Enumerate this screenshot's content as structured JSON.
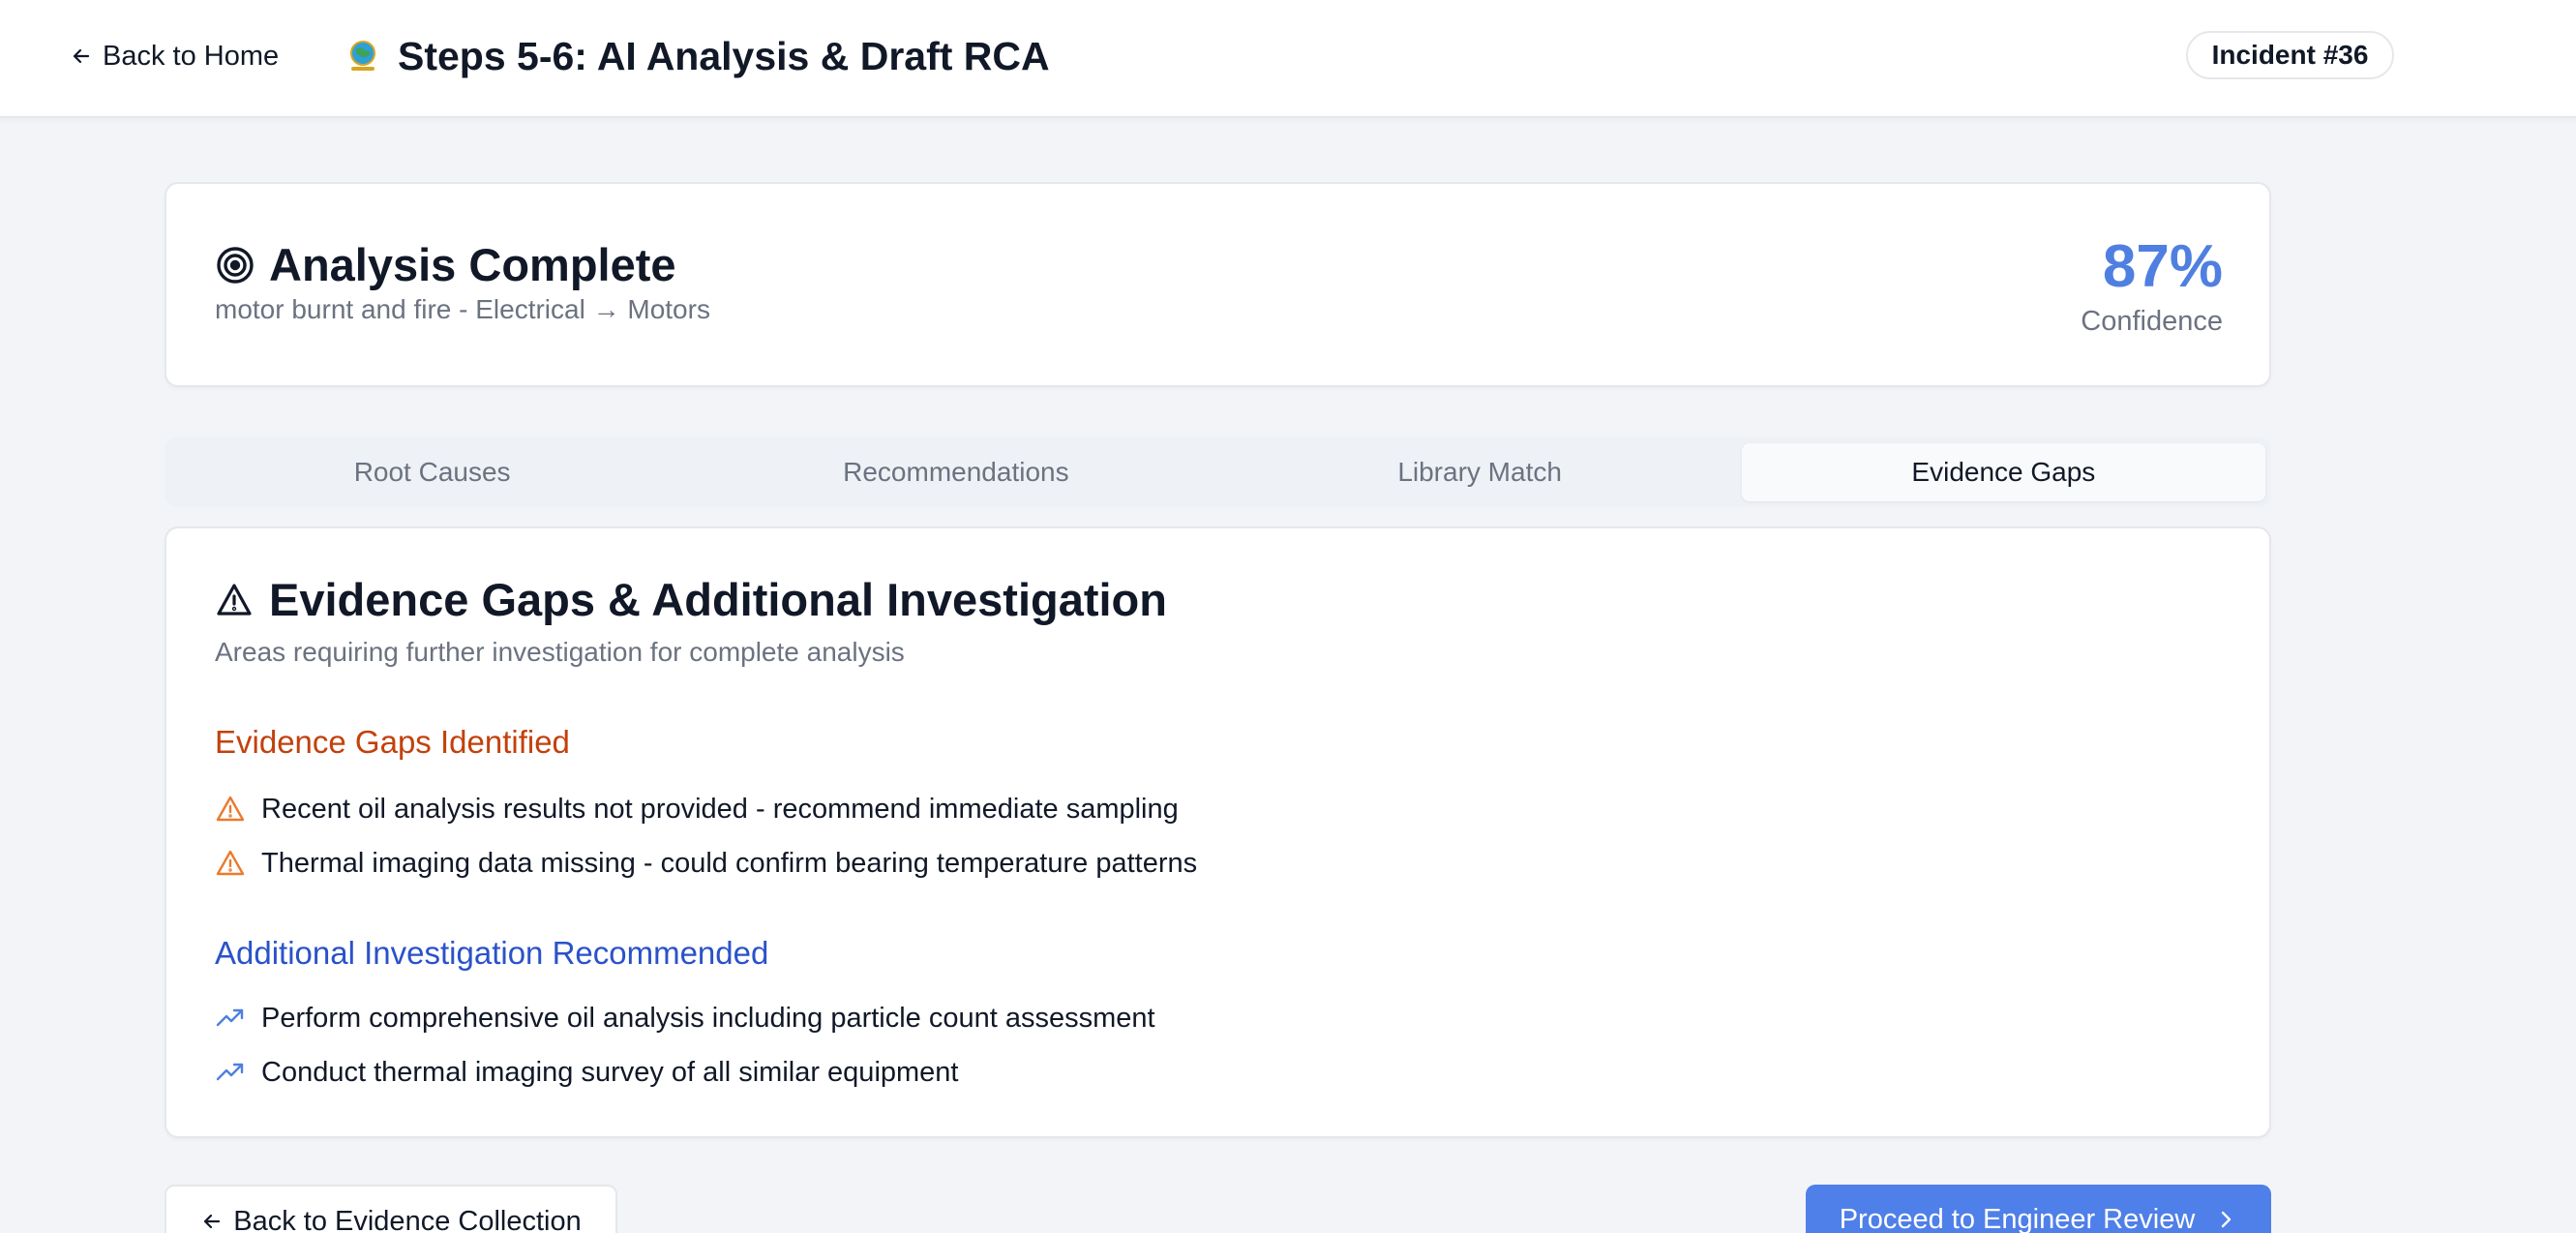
{
  "header": {
    "back_label": "Back to Home",
    "title": "Steps 5-6: AI Analysis & Draft RCA",
    "incident_badge": "Incident #36",
    "logo_icon": "globe-logo-icon"
  },
  "summary": {
    "icon": "target-icon",
    "title": "Analysis Complete",
    "subtitle": "motor burnt and fire - Electrical → Motors",
    "confidence_value": "87%",
    "confidence_label": "Confidence"
  },
  "tabs": [
    {
      "label": "Root Causes",
      "active": false
    },
    {
      "label": "Recommendations",
      "active": false
    },
    {
      "label": "Library Match",
      "active": false
    },
    {
      "label": "Evidence Gaps",
      "active": true
    }
  ],
  "evidence": {
    "icon": "warning-triangle-icon",
    "title": "Evidence Gaps & Additional Investigation",
    "subtitle": "Areas requiring further investigation for complete analysis",
    "gaps_heading": "Evidence Gaps Identified",
    "gaps": [
      "Recent oil analysis results not provided - recommend immediate sampling",
      "Thermal imaging data missing - could confirm bearing temperature patterns"
    ],
    "investigation_heading": "Additional Investigation Recommended",
    "investigations": [
      "Perform comprehensive oil analysis including particle count assessment",
      "Conduct thermal imaging survey of all similar equipment"
    ]
  },
  "footer": {
    "back_button": "Back to Evidence Collection",
    "next_button": "Proceed to Engineer Review"
  },
  "colors": {
    "accent_blue": "#4f7fe8",
    "confidence_blue": "#4f7fe0",
    "gap_orange": "#c2410c",
    "gap_icon_orange": "#ea7a2c",
    "investigation_blue": "#2a52c9",
    "background": "#f3f4f8"
  }
}
